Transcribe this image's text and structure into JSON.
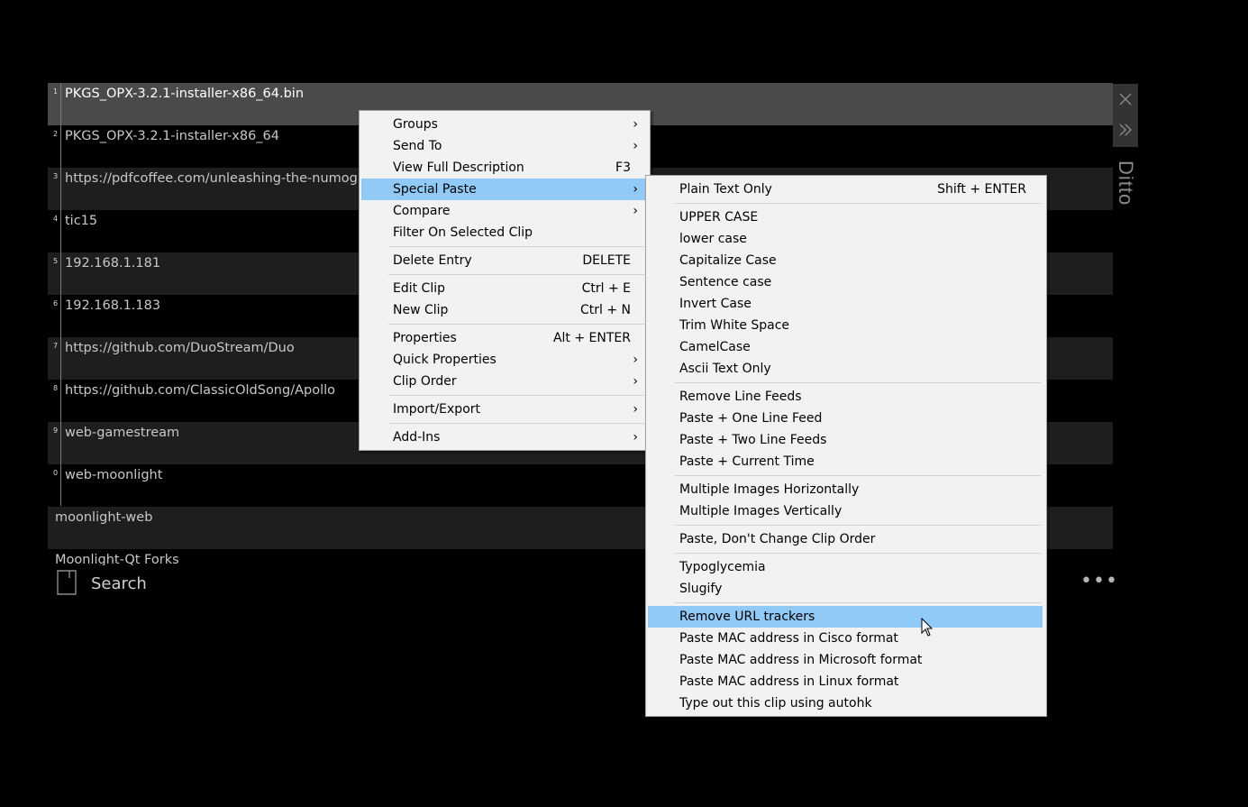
{
  "app": {
    "title": "Ditto"
  },
  "clips": [
    {
      "index": "1",
      "text": "PKGS_OPX-3.2.1-installer-x86_64.bin",
      "selected": true
    },
    {
      "index": "2",
      "text": "PKGS_OPX-3.2.1-installer-x86_64"
    },
    {
      "index": "3",
      "text": "https://pdfcoffee.com/unleashing-the-numogra"
    },
    {
      "index": "4",
      "text": "tic15"
    },
    {
      "index": "5",
      "text": "192.168.1.181"
    },
    {
      "index": "6",
      "text": "192.168.1.183"
    },
    {
      "index": "7",
      "text": "https://github.com/DuoStream/Duo"
    },
    {
      "index": "8",
      "text": "https://github.com/ClassicOldSong/Apollo"
    },
    {
      "index": "9",
      "text": "web-gamestream"
    },
    {
      "index": "0",
      "text": "web-moonlight"
    },
    {
      "index": "",
      "text": "moonlight-web"
    },
    {
      "index": "",
      "text": "Moonlight-Qt Forks"
    }
  ],
  "search": {
    "placeholder": "Search"
  },
  "icons": {
    "close": "close-icon",
    "expand": "double-chevron-right-icon",
    "search": "document-icon",
    "more": "ellipsis-icon",
    "submenu": "chevron-right-icon",
    "cursor": "mouse-pointer-icon"
  },
  "context_menu": {
    "items": [
      {
        "label": "Groups",
        "submenu": true
      },
      {
        "label": "Send To",
        "submenu": true
      },
      {
        "label": "View Full Description",
        "shortcut": "F3"
      },
      {
        "label": "Special Paste",
        "submenu": true,
        "highlighted": true
      },
      {
        "label": "Compare",
        "submenu": true
      },
      {
        "label": "Filter On Selected Clip"
      },
      {
        "label": "Delete Entry",
        "shortcut": "DELETE"
      },
      {
        "label": "Edit Clip",
        "shortcut": "Ctrl + E"
      },
      {
        "label": "New Clip",
        "shortcut": "Ctrl + N"
      },
      {
        "label": "Properties",
        "shortcut": "Alt + ENTER"
      },
      {
        "label": "Quick Properties",
        "submenu": true
      },
      {
        "label": "Clip Order",
        "submenu": true
      },
      {
        "label": "Import/Export",
        "submenu": true
      },
      {
        "label": "Add-Ins",
        "submenu": true
      }
    ]
  },
  "special_paste_menu": {
    "items": [
      {
        "label": "Plain Text Only",
        "shortcut": "Shift + ENTER"
      },
      {
        "label": "UPPER CASE"
      },
      {
        "label": "lower case"
      },
      {
        "label": "Capitalize Case"
      },
      {
        "label": "Sentence case"
      },
      {
        "label": "Invert Case"
      },
      {
        "label": "Trim White Space"
      },
      {
        "label": "CamelCase"
      },
      {
        "label": "Ascii Text Only"
      },
      {
        "label": "Remove Line Feeds"
      },
      {
        "label": "Paste + One Line Feed"
      },
      {
        "label": "Paste + Two Line Feeds"
      },
      {
        "label": "Paste + Current Time"
      },
      {
        "label": "Multiple Images Horizontally"
      },
      {
        "label": "Multiple Images Vertically"
      },
      {
        "label": "Paste, Don't Change Clip Order"
      },
      {
        "label": "Typoglycemia"
      },
      {
        "label": "Slugify"
      },
      {
        "label": "Remove URL trackers",
        "highlighted": true
      },
      {
        "label": "Paste MAC address in Cisco format"
      },
      {
        "label": "Paste MAC address in Microsoft format"
      },
      {
        "label": "Paste MAC address in Linux format"
      },
      {
        "label": "Type out this clip using autohk"
      }
    ]
  },
  "colors": {
    "background": "#000000",
    "selected_row": "#4a4a4a",
    "alt_row": "#1e1e1e",
    "menu_bg": "#f2f2f2",
    "menu_highlight": "#91c9f7"
  }
}
